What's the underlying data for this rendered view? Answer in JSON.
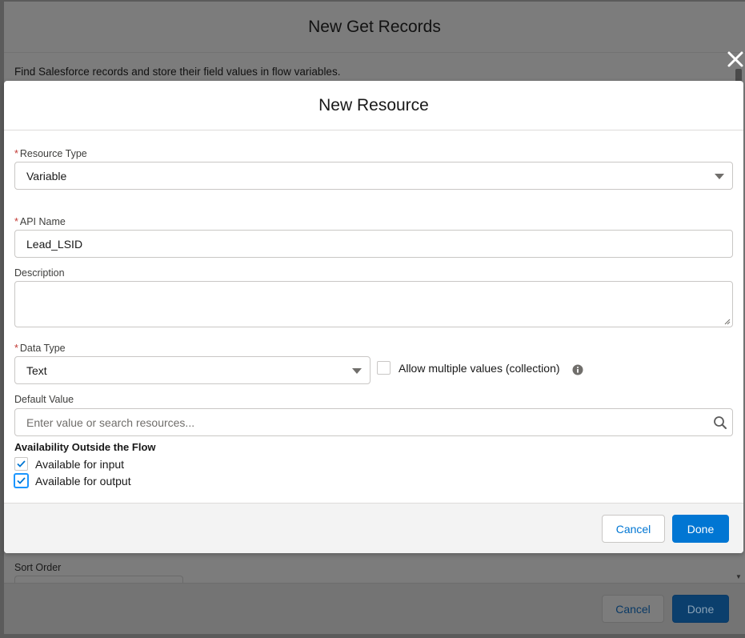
{
  "background_modal": {
    "title": "New Get Records",
    "description": "Find Salesforce records and store their field values in flow variables.",
    "sort_order_label": "Sort Order",
    "cancel_label": "Cancel",
    "done_label": "Done"
  },
  "modal": {
    "title": "New Resource",
    "required_marker": "*",
    "resource_type": {
      "label": "Resource Type",
      "value": "Variable"
    },
    "api_name": {
      "label": "API Name",
      "value": "Lead_LSID"
    },
    "description": {
      "label": "Description",
      "value": ""
    },
    "data_type": {
      "label": "Data Type",
      "value": "Text"
    },
    "allow_multiple": {
      "label": "Allow multiple values (collection)",
      "checked": false
    },
    "default_value": {
      "label": "Default Value",
      "placeholder": "Enter value or search resources..."
    },
    "availability": {
      "heading": "Availability Outside the Flow",
      "input_label": "Available for input",
      "input_checked": true,
      "output_label": "Available for output",
      "output_checked": true
    },
    "footer": {
      "cancel_label": "Cancel",
      "done_label": "Done"
    }
  },
  "icons": {
    "close": "close-icon",
    "info": "info-icon",
    "search": "search-icon",
    "dropdown": "chevron-down-icon",
    "check": "check-icon"
  },
  "colors": {
    "brand": "#0176d3",
    "required": "#c23934",
    "border": "#c9c7c5",
    "overlay": "#7c7c7c"
  }
}
